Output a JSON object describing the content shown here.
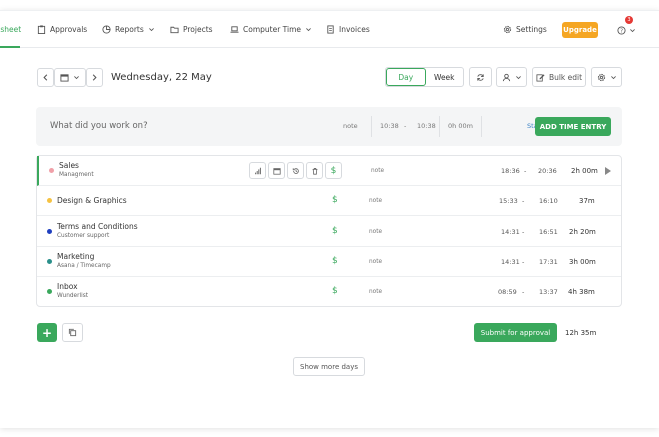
{
  "nav": {
    "timesheet": "Timesheet",
    "approvals": "Approvals",
    "reports": "Reports",
    "projects": "Projects",
    "computer_time": "Computer Time",
    "invoices": "Invoices",
    "settings": "Settings",
    "upgrade": "Upgrade",
    "notification_count": "3"
  },
  "toolbar": {
    "date": "Wednesday, 22 May",
    "day": "Day",
    "week": "Week",
    "bulk_edit": "Bulk edit"
  },
  "entry": {
    "placeholder": "What did you work on?",
    "note": "note",
    "start": "10:38",
    "dash": "-",
    "end": "10:38",
    "duration": "0h 00m",
    "start_timer": "Start timer",
    "add": "ADD TIME ENTRY"
  },
  "rows": [
    {
      "name": "Sales",
      "sub": "Managment",
      "color": "#f0a0a8",
      "note": "note",
      "start": "18:36",
      "dash": "-",
      "end": "20:36",
      "dur": "2h 00m"
    },
    {
      "name": "Design & Graphics",
      "sub": "",
      "color": "#f5c242",
      "note": "note",
      "start": "15:33",
      "dash": "-",
      "end": "16:10",
      "dur": "37m"
    },
    {
      "name": "Terms and Conditions",
      "sub": "Customer support",
      "color": "#1f3fbf",
      "note": "note",
      "start": "14:31",
      "dash": "-",
      "end": "16:51",
      "dur": "2h 20m"
    },
    {
      "name": "Marketing",
      "sub": "Asana / Timecamp",
      "color": "#2a8f8a",
      "note": "note",
      "start": "14:31",
      "dash": "-",
      "end": "17:31",
      "dur": "3h 00m"
    },
    {
      "name": "Inbox",
      "sub": "Wunderlist",
      "color": "#3aa85c",
      "note": "note",
      "start": "08:59",
      "dash": "-",
      "end": "13:37",
      "dur": "4h 38m"
    }
  ],
  "footer": {
    "submit": "Submit for approval",
    "total": "12h 35m",
    "show_more": "Show more days"
  },
  "colors": {
    "accent": "#3aa85c",
    "upgrade": "#f5a623",
    "badge": "#e53935"
  }
}
